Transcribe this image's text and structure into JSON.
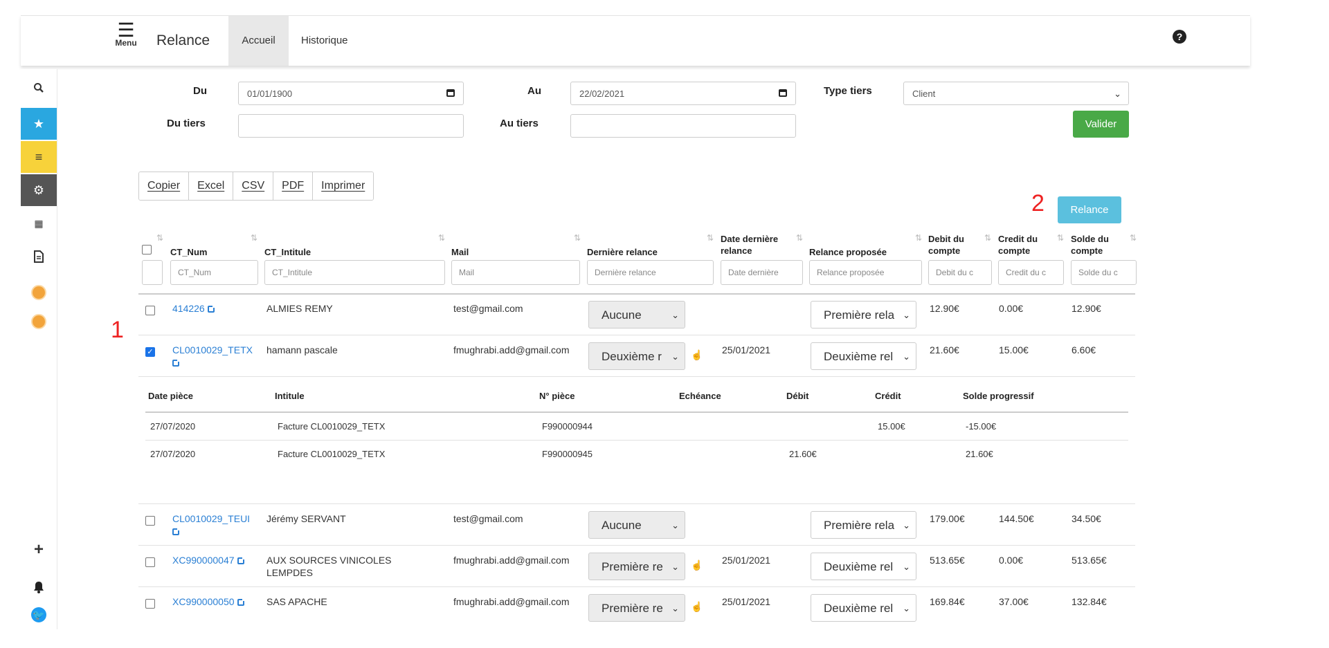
{
  "header": {
    "menu_label": "Menu",
    "app_title": "Relance",
    "tabs": [
      "Accueil",
      "Historique"
    ]
  },
  "sidebar": {
    "icons": [
      "search-icon",
      "star-icon",
      "list-icon",
      "gear-icon",
      "grid-icon",
      "document-icon",
      "orb-icon",
      "orb-icon",
      "plus-icon",
      "bell-icon",
      "twitter-icon"
    ]
  },
  "filters": {
    "du_label": "Du",
    "du_value": "01/01/1900",
    "au_label": "Au",
    "au_value": "22/02/2021",
    "type_label": "Type tiers",
    "type_value": "Client",
    "du_tiers_label": "Du tiers",
    "au_tiers_label": "Au tiers",
    "valider": "Valider"
  },
  "export_buttons": [
    "Copier",
    "Excel",
    "CSV",
    "PDF",
    "Imprimer"
  ],
  "annotations": {
    "one": "1",
    "two": "2"
  },
  "relance_button": "Relance",
  "table": {
    "headers": {
      "ct_num": "CT_Num",
      "ct_intitule": "CT_Intitule",
      "mail": "Mail",
      "derniere_relance": "Dernière relance",
      "date_derniere_1": "Date dernière",
      "date_derniere_2": "relance",
      "relance_proposee": "Relance proposée",
      "debit_1": "Debit du",
      "debit_2": "compte",
      "credit_1": "Credit du",
      "credit_2": "compte",
      "solde_1": "Solde du",
      "solde_2": "compte"
    },
    "filter_placeholders": {
      "ct_num": "CT_Num",
      "ct_intitule": "CT_Intitule",
      "mail": "Mail",
      "derniere_relance": "Dernière relance",
      "date_derniere": "Date dernière",
      "relance_proposee": "Relance proposée",
      "debit": "Debit du c",
      "credit": "Credit du c",
      "solde": "Solde du c"
    },
    "rows": [
      {
        "ct_num": "414226",
        "intitule": "ALMIES REMY",
        "mail": "test@gmail.com",
        "derniere": "Aucune",
        "date": "",
        "proposee": "Première rela",
        "debit": "12.90€",
        "credit": "0.00€",
        "solde": "12.90€",
        "checked": false
      },
      {
        "ct_num": "CL0010029_TETX",
        "intitule": "hamann pascale",
        "mail": "fmughrabi.add@gmail.com",
        "derniere": "Deuxième r",
        "date": "25/01/2021",
        "proposee": "Deuxième rel",
        "debit": "21.60€",
        "credit": "15.00€",
        "solde": "6.60€",
        "checked": true
      },
      {
        "ct_num": "CL0010029_TEUI",
        "intitule": "Jérémy SERVANT",
        "mail": "test@gmail.com",
        "derniere": "Aucune",
        "date": "",
        "proposee": "Première rela",
        "debit": "179.00€",
        "credit": "144.50€",
        "solde": "34.50€",
        "checked": false
      },
      {
        "ct_num": "XC990000047",
        "intitule_1": "AUX SOURCES VINICOLES",
        "intitule_2": "LEMPDES",
        "mail": "fmughrabi.add@gmail.com",
        "derniere": "Première re",
        "date": "25/01/2021",
        "proposee": "Deuxième rel",
        "debit": "513.65€",
        "credit": "0.00€",
        "solde": "513.65€",
        "checked": false
      },
      {
        "ct_num": "XC990000050",
        "intitule": "SAS APACHE",
        "mail": "fmughrabi.add@gmail.com",
        "derniere": "Première re",
        "date": "25/01/2021",
        "proposee": "Deuxième rel",
        "debit": "169.84€",
        "credit": "37.00€",
        "solde": "132.84€",
        "checked": false
      }
    ]
  },
  "detail": {
    "headers": {
      "date_piece": "Date pièce",
      "intitule": "Intitule",
      "n_piece": "N° pièce",
      "echeance": "Echéance",
      "debit": "Débit",
      "credit": "Crédit",
      "solde": "Solde progressif"
    },
    "rows": [
      {
        "date": "27/07/2020",
        "intitule": "Facture CL0010029_TETX",
        "piece": "F990000944",
        "debit": "",
        "credit": "15.00€",
        "solde": "-15.00€"
      },
      {
        "date": "27/07/2020",
        "intitule": "Facture CL0010029_TETX",
        "piece": "F990000945",
        "debit": "21.60€",
        "credit": "",
        "solde": "21.60€"
      }
    ]
  }
}
